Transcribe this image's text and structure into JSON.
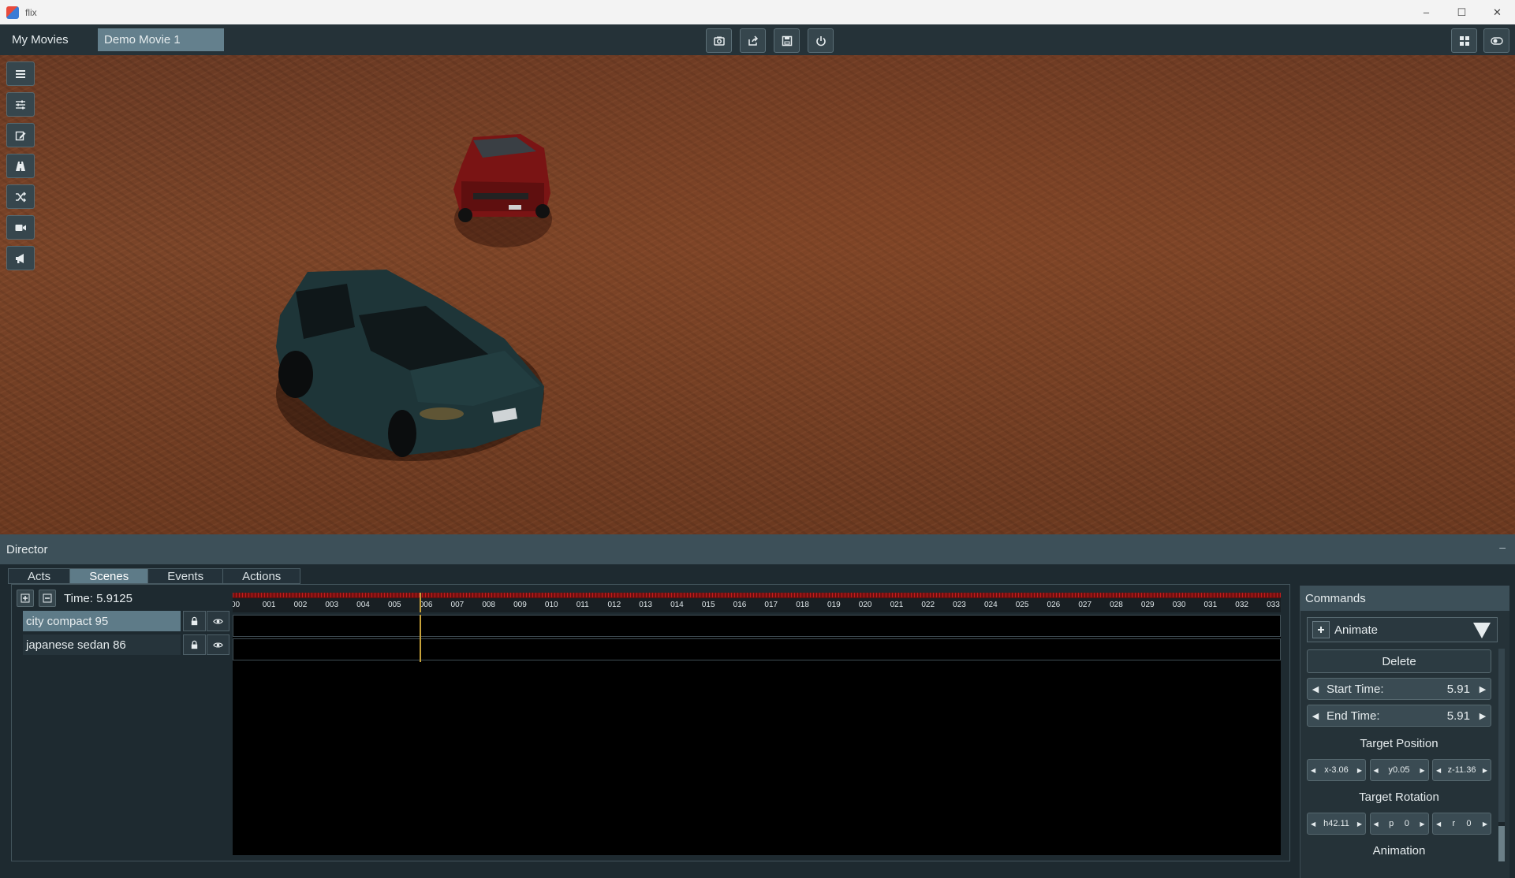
{
  "window": {
    "title": "flix",
    "minimize": "–",
    "maximize": "☐",
    "close": "✕"
  },
  "topbar": {
    "tabs": [
      {
        "label": "My Movies"
      },
      {
        "label": "Demo Movie 1"
      }
    ],
    "buttons": [
      "camera-icon",
      "share-icon",
      "save-icon",
      "power-icon",
      "grid-icon",
      "toggle-icon"
    ]
  },
  "side_tools": [
    "menu-icon",
    "sliders-icon",
    "edit-icon",
    "road-icon",
    "shuffle-icon",
    "video-camera-icon",
    "megaphone-icon"
  ],
  "director": {
    "title": "Director",
    "minimize": "–",
    "tabs": [
      {
        "label": "Acts"
      },
      {
        "label": "Scenes"
      },
      {
        "label": "Events"
      },
      {
        "label": "Actions"
      }
    ],
    "active_tab": "Scenes",
    "time_label": "Time: 5.9125",
    "tracks": [
      {
        "name": "city compact 95"
      },
      {
        "name": "japanese sedan 86"
      }
    ],
    "ruler_ticks": [
      "00",
      "001",
      "002",
      "003",
      "004",
      "005",
      "006",
      "007",
      "008",
      "009",
      "010",
      "011",
      "012",
      "013",
      "014",
      "015",
      "016",
      "017",
      "018",
      "019",
      "020",
      "021",
      "022",
      "023",
      "024",
      "025",
      "026",
      "027",
      "028",
      "029",
      "030",
      "031",
      "032",
      "033"
    ],
    "playhead_time": 5.9125
  },
  "commands": {
    "title": "Commands",
    "command_type": "Animate",
    "delete_label": "Delete",
    "start_time": {
      "label": "Start Time:",
      "value": "5.91"
    },
    "end_time": {
      "label": "End Time:",
      "value": "5.91"
    },
    "target_position": {
      "title": "Target Position",
      "x": "x-3.06",
      "y": "y0.05",
      "z": "z-11.36"
    },
    "target_rotation": {
      "title": "Target Rotation",
      "h": "h42.11",
      "p": "p",
      "p_val": "0",
      "r": "r",
      "r_val": "0"
    },
    "animation_title": "Animation"
  },
  "colors": {
    "accent": "#5e7b88",
    "panel": "#253238",
    "playhead": "#c7a23a",
    "ruler_red": "#c01d1d"
  }
}
